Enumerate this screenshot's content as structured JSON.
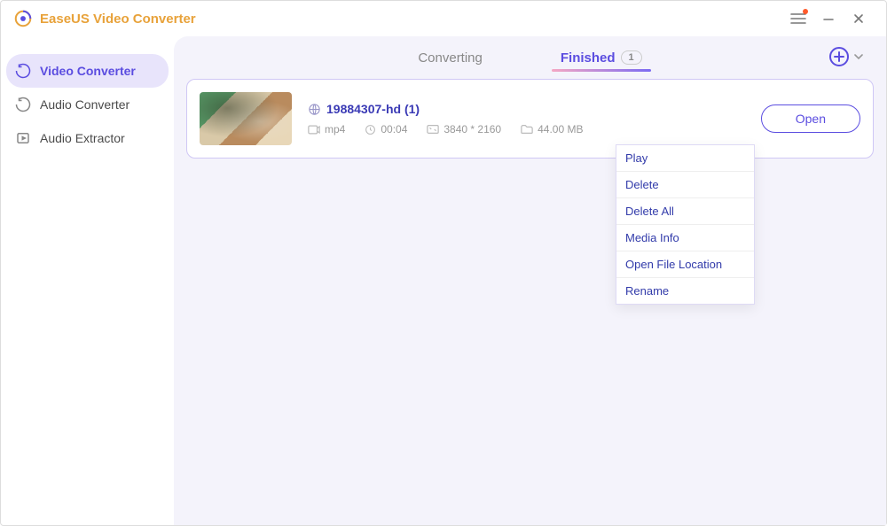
{
  "app": {
    "title": "EaseUS Video Converter"
  },
  "sidebar": {
    "items": [
      {
        "label": "Video Converter",
        "icon": "video",
        "active": true
      },
      {
        "label": "Audio Converter",
        "icon": "audio",
        "active": false
      },
      {
        "label": "Audio Extractor",
        "icon": "extract",
        "active": false
      }
    ]
  },
  "tabs": {
    "converting": {
      "label": "Converting"
    },
    "finished": {
      "label": "Finished",
      "count": "1"
    }
  },
  "file": {
    "name": "19884307-hd (1)",
    "format": "mp4",
    "duration": "00:04",
    "resolution": "3840 * 2160",
    "size": "44.00 MB",
    "open_label": "Open"
  },
  "context_menu": {
    "items": [
      "Play",
      "Delete",
      "Delete All",
      "Media Info",
      "Open File Location",
      "Rename"
    ]
  }
}
